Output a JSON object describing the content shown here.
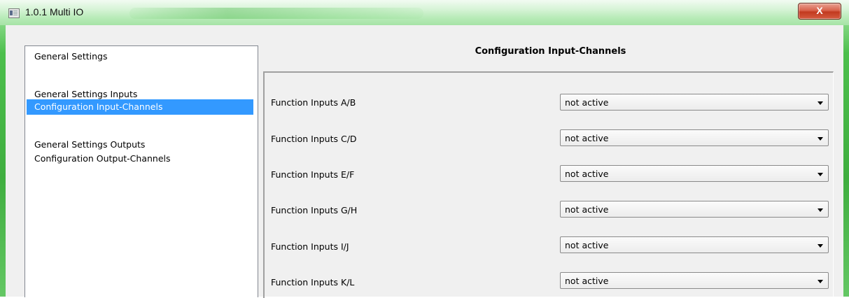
{
  "window": {
    "title": "1.0.1 Multi IO",
    "close_label": "X"
  },
  "nav": {
    "items": [
      {
        "label": "General Settings",
        "selected": false
      },
      {
        "label": "General Settings Inputs",
        "selected": false
      },
      {
        "label": "Configuration Input-Channels",
        "selected": true
      },
      {
        "label": "General Settings Outputs",
        "selected": false
      },
      {
        "label": "Configuration Output-Channels",
        "selected": false
      }
    ]
  },
  "panel": {
    "title": "Configuration Input-Channels",
    "rows": [
      {
        "label": "Function Inputs A/B",
        "value": "not active"
      },
      {
        "label": "Function Inputs C/D",
        "value": "not active"
      },
      {
        "label": "Function Inputs E/F",
        "value": "not active"
      },
      {
        "label": "Function Inputs G/H",
        "value": "not active"
      },
      {
        "label": "Function Inputs I/J",
        "value": "not active"
      },
      {
        "label": "Function Inputs K/L",
        "value": "not active"
      }
    ]
  },
  "colors": {
    "selection": "#3399ff",
    "frame": "#4cbf4c",
    "close_button": "#c23a20"
  }
}
